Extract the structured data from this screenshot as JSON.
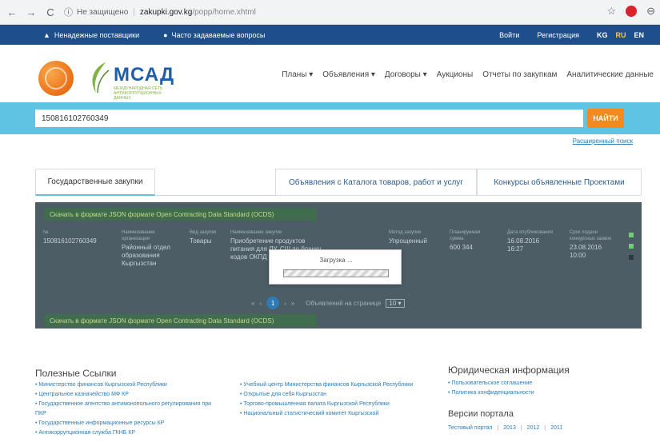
{
  "browser": {
    "security_label": "Не защищено",
    "host": "zakupki.gov.kg",
    "path": "/popp/home.xhtml"
  },
  "topbar": {
    "unreliable_suppliers": "Ненадежные поставщики",
    "faq": "Часто задаваемые вопросы",
    "login": "Войти",
    "register": "Регистрация",
    "languages": [
      "KG",
      "RU",
      "EN"
    ],
    "active_language": "RU"
  },
  "header": {
    "brand_name": "МСАД",
    "brand_subtitle": "МЕЖДУНАРОДНАЯ СЕТЬ АНТИКОРРУПЦИОННЫХ ДАННЫХ",
    "menu": [
      "Планы ▾",
      "Объявления ▾",
      "Договоры ▾",
      "Аукционы",
      "Отчеты по закупкам",
      "Аналитические данные"
    ]
  },
  "search": {
    "value": "150816102760349",
    "button_label": "НАЙТИ",
    "advanced_link": "Расширенный поиск"
  },
  "tabs": [
    "Государственные закупки",
    "Объявления с Каталога товаров, работ и услуг",
    "Конкурсы объявленные Проектами"
  ],
  "results": {
    "export_banner": "Скачать в формате JSON формате Open Contracting Data Standard (OCDS)",
    "row": {
      "number_header": "№",
      "number": "150816102760349",
      "org_header": "Наименование организации",
      "org": "Районный отдел образования Кыргызстан",
      "type_header": "Вид закупки",
      "type": "Товары",
      "subject_header": "Наименование закупки",
      "subject": "Приобретение продуктов питания для ЛУ, СШ по бланку кодов ОКПД",
      "method_header": "Метод закупки",
      "method": "Упрощенный",
      "amount_header": "Планируемая сумма",
      "amount": "600 344",
      "pub_header": "Дата опубликования",
      "pub_date": "16.08.2016 16:27",
      "deadline_header": "Срок подачи конкурсных заявок",
      "deadline": "23.08.2016 10:00"
    },
    "pager": {
      "first": "«",
      "prev": "‹",
      "current": "1",
      "next": "›",
      "last": "»",
      "per_page_label": "Объявлений на странице",
      "per_page": "10 ▾"
    }
  },
  "loading": {
    "label": "Загрузка ..."
  },
  "footer": {
    "useful_links_title": "Полезные Ссылки",
    "col1": [
      "Министерство финансов Кыргызской Республики",
      "Центральное казначейство МФ КР",
      "Государственное агентство антимонопольного регулирования при ПКР",
      "Государственные информационные ресурсы КР",
      "Антикоррупционная служба ГКНБ КР"
    ],
    "col2": [
      "Учебный центр Министерства финансов Кыргызской Республики",
      "Открытые для себя Кыргызстан",
      "Торгово-промышленная палата Кыргызской Республики",
      "Национальный статистический комитет Кыргызской"
    ],
    "legal_title": "Юридическая информация",
    "legal": [
      "Пользовательское соглашение",
      "Политика конфиденциальности"
    ],
    "versions_title": "Версии портала",
    "versions": [
      "Тестовый портал",
      "2013",
      "2012",
      "2011"
    ]
  }
}
